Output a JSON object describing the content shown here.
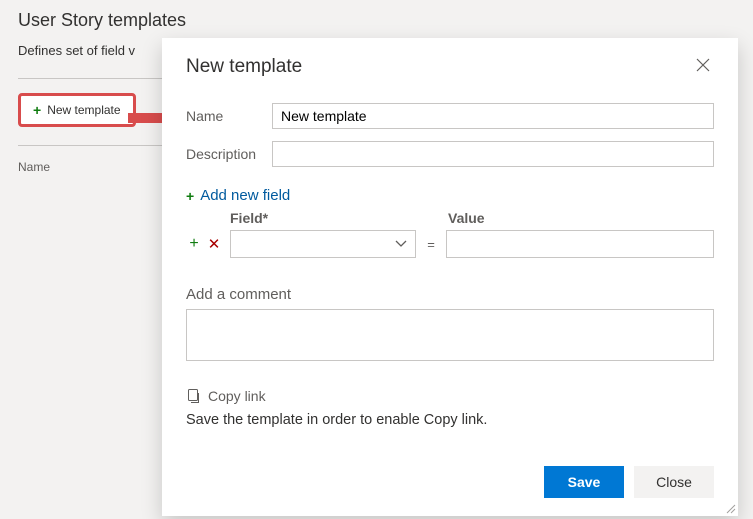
{
  "page": {
    "title": "User Story templates",
    "description": "Defines set of field v",
    "new_template_btn": "New template",
    "column_name": "Name"
  },
  "dialog": {
    "title": "New template",
    "name_label": "Name",
    "name_value": "New template",
    "description_label": "Description",
    "description_value": "",
    "add_field_label": "Add new field",
    "field_header": "Field*",
    "value_header": "Value",
    "equals": "=",
    "field_select_value": "",
    "field_value": "",
    "comment_label": "Add a comment",
    "comment_value": "",
    "copy_link_label": "Copy link",
    "copy_link_hint": "Save the template in order to enable Copy link.",
    "save_label": "Save",
    "close_label": "Close"
  }
}
